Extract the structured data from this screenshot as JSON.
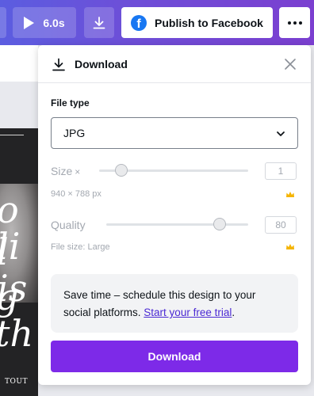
{
  "toolbar": {
    "play_duration": "6.0s",
    "publish_label": "Publish to Facebook",
    "facebook_glyph": "f",
    "accent_gradient": [
      "#5b5de0",
      "#7b3fd0"
    ]
  },
  "panel": {
    "title": "Download",
    "file_type_label": "File type",
    "file_type_value": "JPG",
    "size_label": "Size",
    "size_multiplier_symbol": "×",
    "size_value": "1",
    "size_slider_fraction": 0.15,
    "dimensions": "940 × 788 px",
    "quality_label": "Quality",
    "quality_value": "80",
    "quality_slider_fraction": 0.8,
    "file_size": "File size: Large",
    "promo_text": "Save time – schedule this design to your social platforms. ",
    "promo_link": "Start your free trial",
    "promo_end": ".",
    "download_button": "Download",
    "button_color": "#7d2ae8"
  },
  "background": {
    "script_lines": [
      "o li",
      "l is",
      "g th"
    ],
    "caption": "TOUT"
  },
  "icons": [
    "play-icon",
    "download-icon",
    "facebook-icon",
    "more-icon",
    "close-icon",
    "chevron-down-icon",
    "crown-icon"
  ]
}
